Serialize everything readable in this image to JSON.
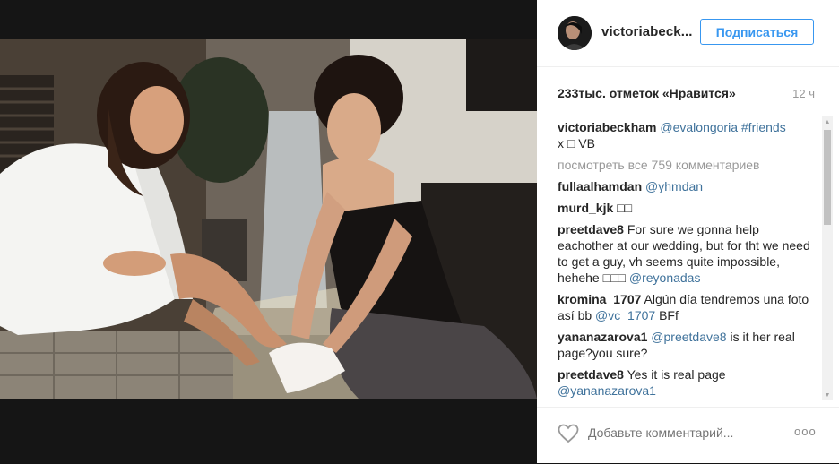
{
  "post": {
    "header": {
      "username": "victoriabeck...",
      "follow_label": "Подписаться"
    },
    "likes_text": "233тыс. отметок «Нравится»",
    "time_ago": "12 ч",
    "caption": {
      "author": "victoriabeckham",
      "mention": "@evalongoria",
      "hashtag": "#friends",
      "rest": "x □ VB"
    },
    "view_all": "посмотреть все 759 комментариев",
    "comments": [
      {
        "author": "fullaalhamdan",
        "text": "",
        "mention": "@yhmdan",
        "after": ""
      },
      {
        "author": "murd_kjk",
        "text": "□□",
        "mention": "",
        "after": ""
      },
      {
        "author": "preetdave8",
        "text": "For sure we gonna help eachother at our wedding, but for tht we need to get a guy, vh seems quite impossible, hehehe □□□",
        "mention": "@reyonadas",
        "after": ""
      },
      {
        "author": "kromina_1707",
        "text": "Algún día tendremos una foto así bb",
        "mention": "@vc_1707",
        "after": "BFf"
      },
      {
        "author": "yananazarova1",
        "text": "",
        "mention": "@preetdave8",
        "after": "is it her real page?you sure?"
      },
      {
        "author": "preetdave8",
        "text": "Yes it is real page",
        "mention": "@yananazarova1",
        "after": ""
      }
    ],
    "footer": {
      "comment_placeholder": "Добавьте комментарий...",
      "more_label": "ooo"
    }
  },
  "icons": {
    "like": "heart-outline-icon",
    "more": "more-options-icon",
    "scroll_up": "scroll-up-arrow",
    "scroll_down": "scroll-down-arrow"
  },
  "colors": {
    "link": "#3f729b",
    "follow": "#3897f0",
    "muted": "#999999"
  }
}
